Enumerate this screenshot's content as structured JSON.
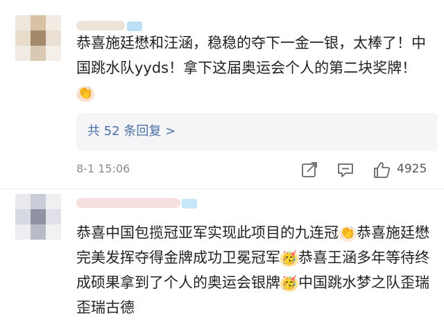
{
  "comments": [
    {
      "text": "恭喜施廷懋和汪涵，稳稳的夺下一金一银，太棒了！中国跳水队yyds！拿下这届奥运会个人的第二块奖牌！",
      "emoji_1": "👏",
      "reply_label": "共 52 条回复 >",
      "time": "8-1 15:06",
      "likes": "4925",
      "icons": {
        "share": "share-icon",
        "comment": "comment-icon",
        "like": "thumbs-up-icon"
      }
    },
    {
      "text_1": "恭喜中国包揽冠亚军实现此项目的九连冠",
      "emoji_1": "👏",
      "text_2": "恭喜施廷懋完美发挥夺得金牌成功卫冕冠军",
      "emoji_2": "🥳",
      "text_3": "恭喜王涵多年等待终成硕果拿到了个人的奥运会银牌",
      "emoji_3": "🥳",
      "text_4": "中国跳水梦之队歪瑞歪瑞古德"
    }
  ],
  "colors": {
    "reply_link": "#4a6fa5",
    "meta_gray": "#8c8c8c",
    "reply_bg": "#f5f5f7"
  }
}
